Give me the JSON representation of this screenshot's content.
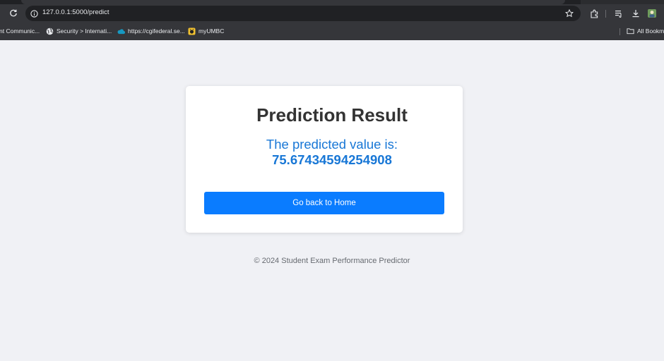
{
  "browser": {
    "url": "127.0.0.1:5000/predict",
    "bookmarks": [
      {
        "label": "nt Communic...",
        "icon": "none"
      },
      {
        "label": "Security > Internati...",
        "icon": "globe-icon"
      },
      {
        "label": "https://cgifederal.se...",
        "icon": "cloud-icon"
      },
      {
        "label": "myUMBC",
        "icon": "umbc-icon"
      }
    ],
    "all_bookmarks_label": "All Bookma",
    "colors": {
      "frame": "#35363a",
      "omnibox": "#202124",
      "text": "#e8eaed"
    }
  },
  "page": {
    "title": "Prediction Result",
    "predicted_label": "The predicted value is:",
    "predicted_value": "75.67434594254908",
    "home_button_label": "Go back to Home",
    "footer": "© 2024 Student Exam Performance Predictor",
    "colors": {
      "background": "#f0f1f5",
      "accent": "#1877d6",
      "button": "#0a7cff"
    }
  }
}
